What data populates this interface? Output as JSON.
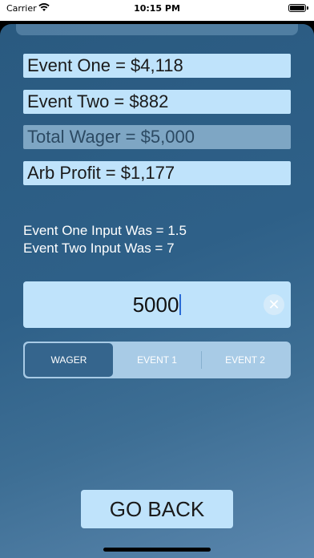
{
  "status_bar": {
    "carrier": "Carrier",
    "time": "10:15 PM",
    "wifi_icon": "wifi-icon",
    "battery_icon": "battery-icon",
    "battery_level": 1.0
  },
  "results": {
    "event_one": "Event One = $4,118",
    "event_two": "Event Two = $882",
    "total_wager": "Total Wager = $5,000",
    "arb_profit": "Arb Profit = $1,177"
  },
  "inputs_info": {
    "event_one_input": "Event One Input Was = 1.5",
    "event_two_input": "Event Two Input Was = 7"
  },
  "amount_field": {
    "value": "5000",
    "clear_icon": "clear-icon"
  },
  "segmented_control": {
    "segments": [
      "WAGER",
      "EVENT 1",
      "EVENT 2"
    ],
    "selected": "WAGER"
  },
  "go_back_label": "GO BACK",
  "colors": {
    "field_background": "#bfe3fb",
    "dim_field_background": "#7ea6c4",
    "selected_segment": "#35658d",
    "sheet_gradient_start": "#2a5a80",
    "sheet_gradient_end": "#5a86ad"
  }
}
